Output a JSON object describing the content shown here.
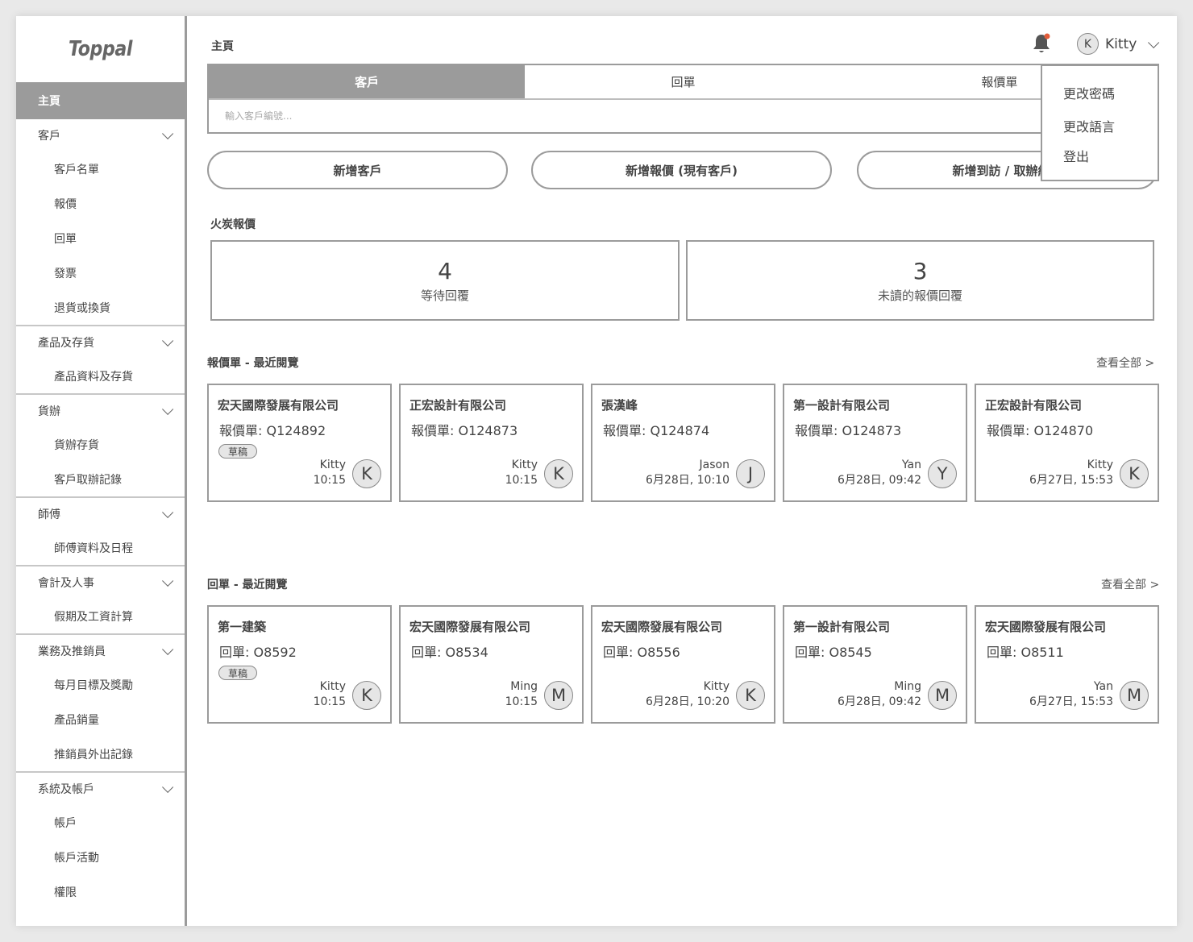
{
  "sidebar": {
    "logo": "Toppal",
    "home": "主頁",
    "sections": [
      {
        "label": "客戶",
        "items": [
          "客戶名單",
          "報價",
          "回單",
          "發票",
          "退貨或換貨"
        ]
      },
      {
        "label": "產品及存貨",
        "items": [
          "產品資料及存貨"
        ]
      },
      {
        "label": "貨辦",
        "items": [
          "貨辦存貨",
          "客戶取辦記錄"
        ]
      },
      {
        "label": "師傅",
        "items": [
          "師傅資料及日程"
        ]
      },
      {
        "label": "會計及人事",
        "items": [
          "假期及工資計算"
        ]
      },
      {
        "label": "業務及推銷員",
        "items": [
          "每月目標及獎勵",
          "產品銷量",
          "推銷員外出記錄"
        ]
      },
      {
        "label": "系統及帳戶",
        "items": [
          "帳戶",
          "帳戶活動",
          "權限"
        ]
      }
    ]
  },
  "header": {
    "title": "主頁",
    "user": {
      "initial": "K",
      "name": "Kitty"
    },
    "dropdown": [
      "更改密碼",
      "更改語言",
      "登出"
    ]
  },
  "search": {
    "tabs": [
      "客戶",
      "回單",
      "報價單"
    ],
    "placeholder": "輸入客戶編號..."
  },
  "actions": [
    "新增客戶",
    "新增報價 (現有客戶)",
    "新增到訪 / 取辦紀錄"
  ],
  "hot_quotes": {
    "title": "火炭報價",
    "stats": [
      {
        "value": "4",
        "label": "等待回覆"
      },
      {
        "value": "3",
        "label": "未讀的報價回覆"
      }
    ]
  },
  "quotes_recent": {
    "title": "報價單 - 最近閱覽",
    "see_all": "查看全部 >",
    "cards": [
      {
        "company": "宏天國際發展有限公司",
        "ref": "報價單: Q124892",
        "badge": "草稿",
        "person": "Kitty",
        "time": "10:15",
        "initial": "K"
      },
      {
        "company": "正宏設計有限公司",
        "ref": "報價單: O124873",
        "badge": "",
        "person": "Kitty",
        "time": "10:15",
        "initial": "K"
      },
      {
        "company": "張漢峰",
        "ref": "報價單: Q124874",
        "badge": "",
        "person": "Jason",
        "time": "6月28日, 10:10",
        "initial": "J"
      },
      {
        "company": "第一設計有限公司",
        "ref": "報價單: O124873",
        "badge": "",
        "person": "Yan",
        "time": "6月28日, 09:42",
        "initial": "Y"
      },
      {
        "company": "正宏設計有限公司",
        "ref": "報價單: O124870",
        "badge": "",
        "person": "Kitty",
        "time": "6月27日, 15:53",
        "initial": "K"
      }
    ]
  },
  "orders_recent": {
    "title": "回單 - 最近閱覽",
    "see_all": "查看全部 >",
    "cards": [
      {
        "company": "第一建築",
        "ref": "回單: O8592",
        "badge": "草稿",
        "person": "Kitty",
        "time": "10:15",
        "initial": "K"
      },
      {
        "company": "宏天國際發展有限公司",
        "ref": "回單: O8534",
        "badge": "",
        "person": "Ming",
        "time": "10:15",
        "initial": "M"
      },
      {
        "company": "宏天國際發展有限公司",
        "ref": "回單: O8556",
        "badge": "",
        "person": "Kitty",
        "time": "6月28日, 10:20",
        "initial": "K"
      },
      {
        "company": "第一設計有限公司",
        "ref": "回單: O8545",
        "badge": "",
        "person": "Ming",
        "time": "6月28日, 09:42",
        "initial": "M"
      },
      {
        "company": "宏天國際發展有限公司",
        "ref": "回單: O8511",
        "badge": "",
        "person": "Yan",
        "time": "6月27日, 15:53",
        "initial": "M"
      }
    ]
  }
}
